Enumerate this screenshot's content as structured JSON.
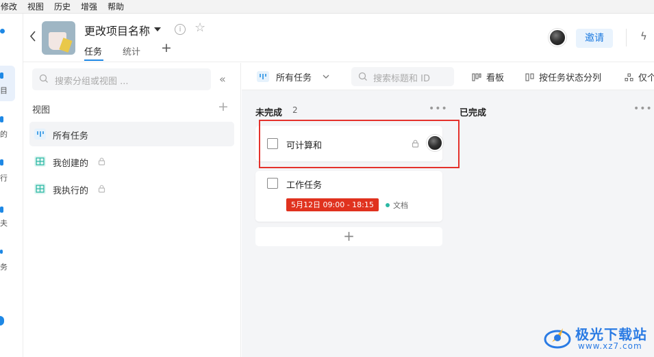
{
  "menu": [
    "修改",
    "视图",
    "历史",
    "增强",
    "帮助"
  ],
  "rail": {
    "labels": [
      "目",
      "的",
      "行",
      "夫",
      "务"
    ]
  },
  "header": {
    "project_title": "更改项目名称",
    "tabs": [
      "任务",
      "统计"
    ],
    "invite_label": "邀请"
  },
  "sidebar": {
    "search_placeholder": "搜索分组或视图 ...",
    "section_title": "视图",
    "views": [
      {
        "label": "所有任务",
        "locked": false,
        "active": true
      },
      {
        "label": "我创建的",
        "locked": true,
        "active": false
      },
      {
        "label": "我执行的",
        "locked": true,
        "active": false
      }
    ]
  },
  "toolbar": {
    "current_view": "所有任务",
    "search_placeholder": "搜索标题和 ID",
    "board_label": "看板",
    "group_label": "按任务状态分列",
    "filter_label": "仅个"
  },
  "columns": [
    {
      "title": "未完成",
      "count": "2",
      "cards": [
        {
          "title": "可计算和",
          "locked": true,
          "has_avatar": true
        },
        {
          "title": "工作任务",
          "date": "5月12日 09:00 - 18:15",
          "tag": "文档"
        }
      ]
    },
    {
      "title": "已完成",
      "count": "",
      "cards": []
    }
  ],
  "watermark": {
    "title": "极光下载站",
    "url": "www.xz7.com"
  },
  "colors": {
    "accent": "#1e88e5",
    "highlight": "#e4312b",
    "date_badge": "#e0321e",
    "tag_dot": "#2bb8a4"
  }
}
